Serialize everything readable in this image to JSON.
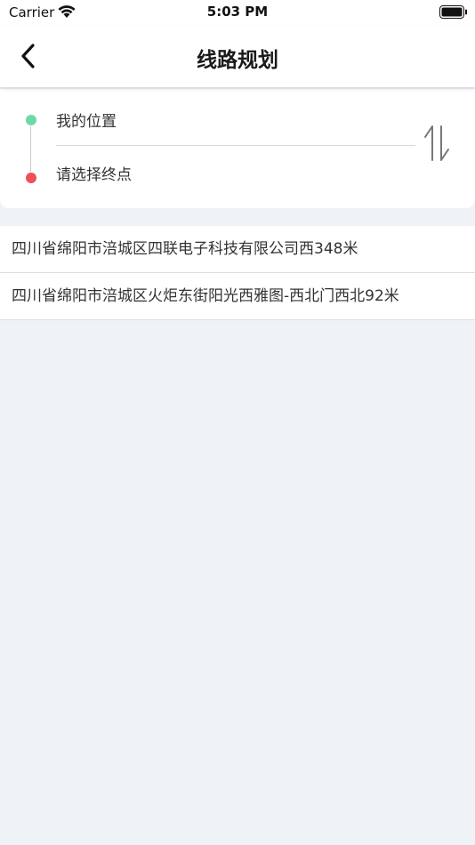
{
  "status_bar": {
    "carrier": "Carrier",
    "time": "5:03 PM",
    "wifi_icon": "wifi-icon",
    "battery_icon": "battery-icon"
  },
  "nav": {
    "title": "线路规划",
    "back_icon": "chevron-left-icon"
  },
  "route": {
    "start_label": "我的位置",
    "end_label": "请选择终点",
    "start_color": "#6ed9a8",
    "end_color": "#f05058",
    "swap_icon": "swap-vertical-icon"
  },
  "suggestions": [
    {
      "text": "四川省绵阳市涪城区四联电子科技有限公司西348米"
    },
    {
      "text": "四川省绵阳市涪城区火炬东街阳光西雅图-西北门西北92米"
    }
  ]
}
